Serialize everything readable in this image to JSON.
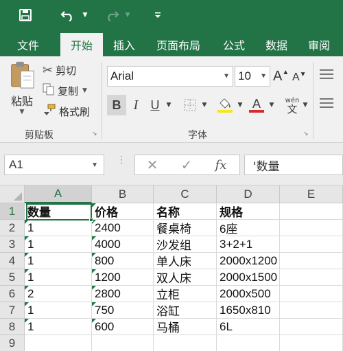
{
  "qat": {
    "save_icon": "save-icon",
    "undo_icon": "undo-icon",
    "redo_icon": "redo-icon",
    "customize_icon": "customize-qat-icon"
  },
  "tabs": [
    {
      "label": "文件",
      "active": false
    },
    {
      "label": "开始",
      "active": true
    },
    {
      "label": "插入",
      "active": false
    },
    {
      "label": "页面布局",
      "active": false
    },
    {
      "label": "公式",
      "active": false
    },
    {
      "label": "数据",
      "active": false
    },
    {
      "label": "审阅",
      "active": false
    }
  ],
  "clipboard": {
    "paste_label": "粘贴",
    "cut_label": "剪切",
    "copy_label": "复制",
    "format_painter_label": "格式刷",
    "group_label": "剪贴板"
  },
  "font": {
    "font_name": "Arial",
    "font_size": "10",
    "increase_label": "A",
    "decrease_label": "A",
    "bold_label": "B",
    "italic_label": "I",
    "underline_label": "U",
    "font_color_label": "A",
    "phonetic_label": "文",
    "phonetic_top": "wén",
    "group_label": "字体",
    "highlight_color": "#f5e71b",
    "font_color": "#d42d2d"
  },
  "formula_bar": {
    "name_box": "A1",
    "cancel_symbol": "✕",
    "enter_symbol": "✓",
    "fx_label": "fx",
    "content": "'数量"
  },
  "grid": {
    "columns": [
      "A",
      "B",
      "C",
      "D",
      "E"
    ],
    "selected_column": "A",
    "rows": [
      "1",
      "2",
      "3",
      "4",
      "5",
      "6",
      "7",
      "8",
      "9"
    ],
    "selected_row": "1",
    "data": [
      [
        "数量",
        "价格",
        "名称",
        "规格",
        ""
      ],
      [
        "1",
        "2400",
        "餐桌椅",
        "6座",
        ""
      ],
      [
        "1",
        "4000",
        "沙发组",
        "3+2+1",
        ""
      ],
      [
        "1",
        "800",
        "单人床",
        "2000x1200",
        ""
      ],
      [
        "1",
        "1200",
        "双人床",
        "2000x1500",
        ""
      ],
      [
        "2",
        "2800",
        "立柜",
        "2000x500",
        ""
      ],
      [
        "1",
        "750",
        "浴缸",
        "1650x810",
        ""
      ],
      [
        "1",
        "600",
        "马桶",
        "6L",
        ""
      ],
      [
        "",
        "",
        "",
        "",
        ""
      ]
    ],
    "active_cell": "A1",
    "accent_color": "#217346"
  },
  "colors": {
    "title_bar": "#227447",
    "ribbon": "#f1f1f1"
  }
}
